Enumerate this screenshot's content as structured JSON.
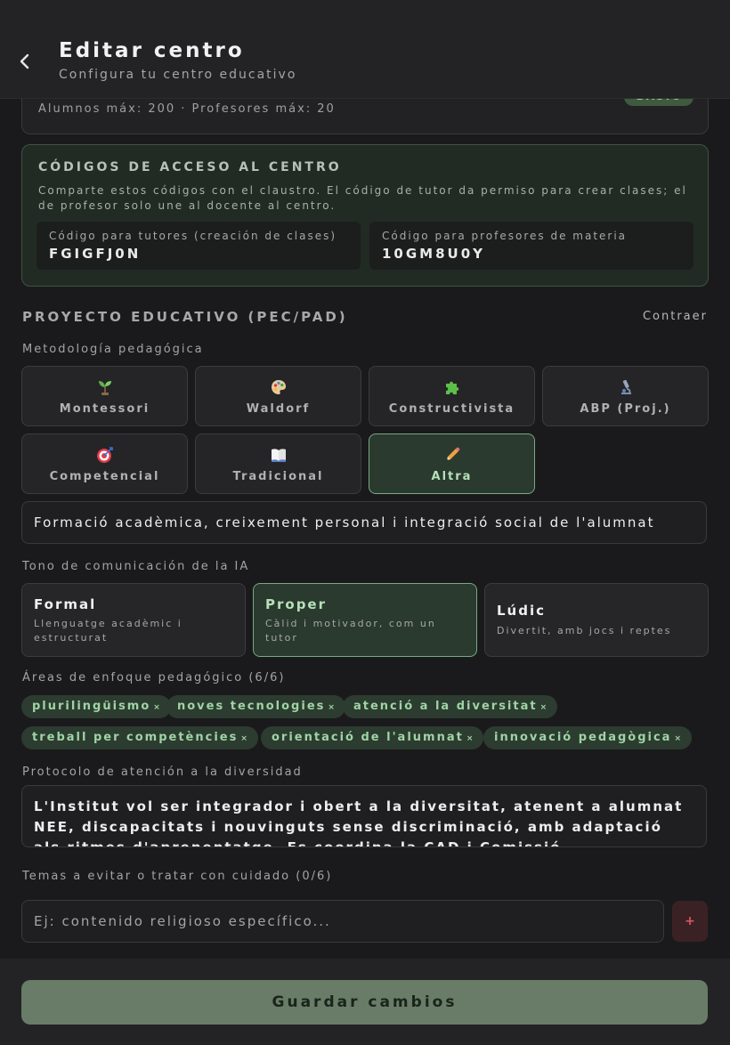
{
  "header": {
    "title": "Editar centro",
    "subtitle": "Configura tu centro educativo"
  },
  "plan": {
    "limits": "Alumnos máx: 200 · Profesores máx: 20",
    "badge": "BASIC"
  },
  "codes": {
    "title": "CÓDIGOS DE ACCESO AL CENTRO",
    "description": "Comparte estos códigos con el claustro. El código de tutor da permiso para crear clases; el de profesor solo une al docente al centro.",
    "tutor_label": "Código para tutores (creación de clases)",
    "tutor_code": "FGIGFJ0N",
    "teacher_label": "Código para profesores de materia",
    "teacher_code": "10GM8U0Y"
  },
  "project": {
    "title": "PROYECTO EDUCATIVO (PEC/PAD)",
    "collapse_label": "Contraer"
  },
  "methodology": {
    "label": "Metodología pedagógica",
    "options": [
      {
        "label": "Montessori",
        "icon": "seedling-icon"
      },
      {
        "label": "Waldorf",
        "icon": "palette-icon"
      },
      {
        "label": "Constructivista",
        "icon": "puzzle-icon"
      },
      {
        "label": "ABP (Proj.)",
        "icon": "microscope-icon"
      },
      {
        "label": "Competencial",
        "icon": "target-icon"
      },
      {
        "label": "Tradicional",
        "icon": "book-icon"
      },
      {
        "label": "Altra",
        "icon": "pencil-icon"
      }
    ],
    "selected": "Altra",
    "custom_value": "Formació acadèmica, creixement personal i integració social de l'alumnat"
  },
  "tone": {
    "label": "Tono de comunicación de la IA",
    "options": [
      {
        "name": "Formal",
        "desc": "Llenguatge acadèmic i estructurat"
      },
      {
        "name": "Proper",
        "desc": "Càlid i motivador, com un tutor"
      },
      {
        "name": "Lúdic",
        "desc": "Divertit, amb jocs i reptes"
      }
    ],
    "selected": "Proper"
  },
  "areas": {
    "label": "Áreas de enfoque pedagógico (6/6)",
    "chips": [
      "plurilingüismo",
      "noves tecnologies",
      "atenció a la diversitat",
      "treball per competències",
      "orientació de l'alumnat",
      "innovació pedagògica"
    ],
    "remove_glyph": "×"
  },
  "diversity": {
    "label": "Protocolo de atención a la diversidad",
    "value": "L'Institut vol ser integrador i obert a la diversitat, atenent a alumnat NEE, discapacitats i nouvinguts sense discriminació, amb adaptació als ritmes d'aprenentatge. Es coordina la CAD i Comissió"
  },
  "avoid": {
    "label": "Temas a evitar o tratar con cuidado (0/6)",
    "placeholder": "Ej: contenido religioso específico...",
    "add_glyph": "+"
  },
  "footer": {
    "save_label": "Guardar cambios"
  },
  "colors": {
    "accent_green": "#7aa884",
    "save_button": "#687c68",
    "danger": "#e05560"
  }
}
